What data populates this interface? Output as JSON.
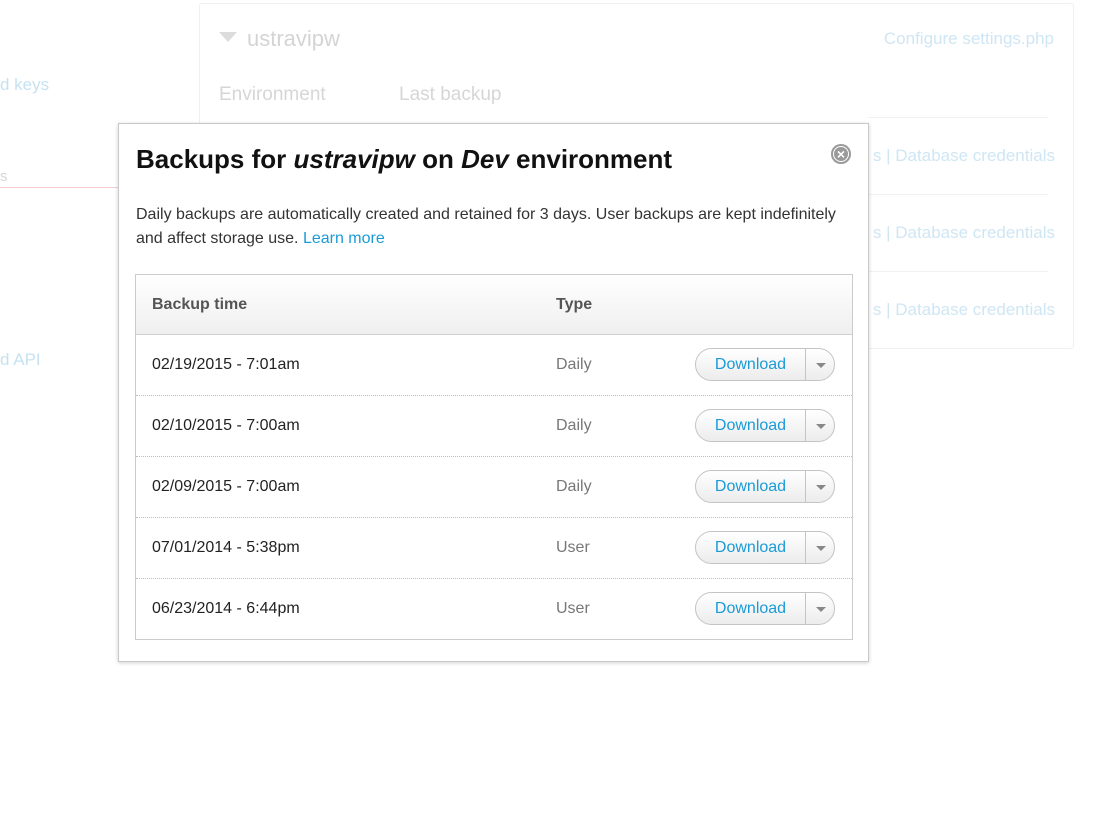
{
  "background": {
    "sidebar": {
      "link_keys": "d keys",
      "active_item": "s",
      "link_api": "d API"
    },
    "site_name": "ustravipw",
    "configure_link": "Configure settings.php",
    "columns": {
      "environment": "Environment",
      "last_backup": "Last backup"
    },
    "row_links": [
      "s | Database credentials",
      "s | Database credentials",
      "s | Database credentials"
    ]
  },
  "modal": {
    "title_prefix": "Backups for ",
    "site": "ustravipw",
    "title_middle": " on ",
    "environment": "Dev",
    "title_suffix": " environment",
    "close_symbol": "×",
    "description": "Daily backups are automatically created and retained for 3 days. User backups are kept indefinitely and affect storage use. ",
    "learn_more": "Learn more",
    "table": {
      "headers": {
        "time": "Backup time",
        "type": "Type"
      },
      "rows": [
        {
          "time": "02/19/2015 - 7:01am",
          "type": "Daily",
          "action": "Download"
        },
        {
          "time": "02/10/2015 - 7:00am",
          "type": "Daily",
          "action": "Download"
        },
        {
          "time": "02/09/2015 - 7:00am",
          "type": "Daily",
          "action": "Download"
        },
        {
          "time": "07/01/2014 - 5:38pm",
          "type": "User",
          "action": "Download"
        },
        {
          "time": "06/23/2014 - 6:44pm",
          "type": "User",
          "action": "Download"
        }
      ]
    }
  },
  "colors": {
    "link": "#1a9bd7",
    "muted_type": "#777777",
    "faded_link": "#cfe6f4"
  }
}
